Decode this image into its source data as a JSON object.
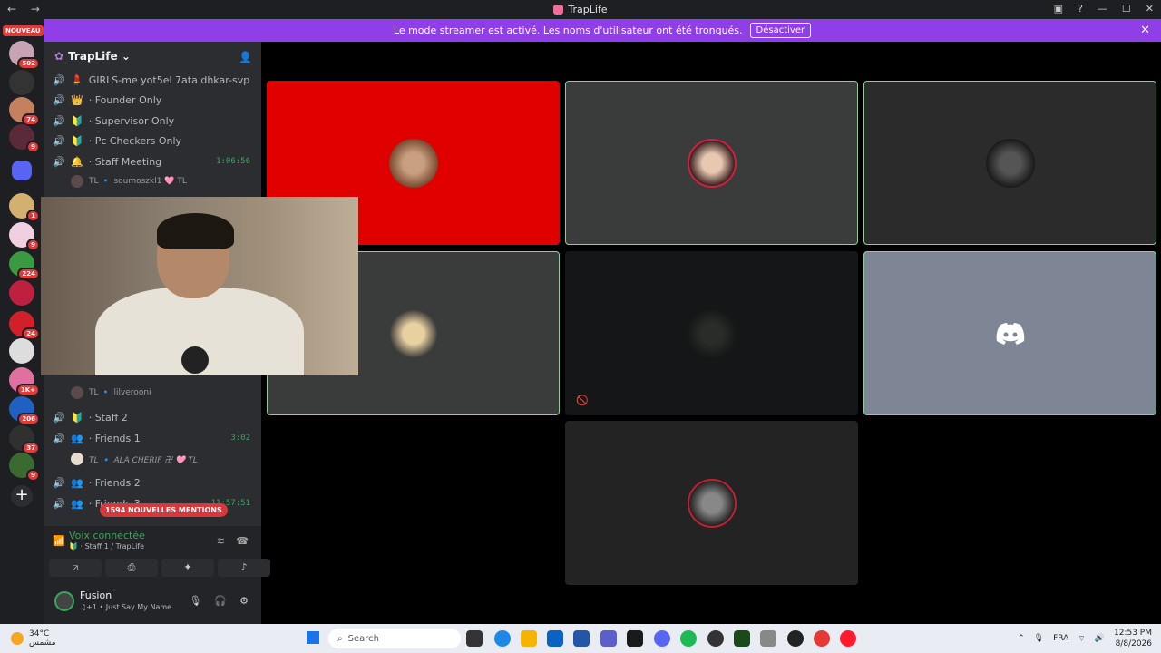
{
  "window": {
    "title": "TrapLife",
    "nav_glyphs": "← →"
  },
  "banner": {
    "text": "Le mode streamer est activé. Les noms d'utilisateur ont été tronqués.",
    "button": "Désactiver",
    "close": "✕"
  },
  "servers": {
    "nouveau": "NOUVEAU",
    "badges": [
      "502",
      "74",
      "9",
      "1",
      "9",
      "224",
      "24",
      "1K+",
      "206",
      "37",
      "9"
    ]
  },
  "guild": {
    "name": "TrapLife ⌄"
  },
  "channels": [
    {
      "icon": "💄",
      "name": "GIRLS-me yot5el 7ata dhkar-svp",
      "time": ""
    },
    {
      "icon": "👑",
      "name": "· Founder Only",
      "time": ""
    },
    {
      "icon": "🔰",
      "name": "· Supervisor Only",
      "time": ""
    },
    {
      "icon": "🔰",
      "name": "· Pc Checkers Only",
      "time": ""
    },
    {
      "icon": "🔔",
      "name": "· Staff Meeting",
      "time": "1:06:56"
    },
    {
      "icon": "🔰",
      "name": "· Staff 2",
      "time": ""
    },
    {
      "icon": "👥",
      "name": "· Friends 1",
      "time": "3:02"
    },
    {
      "icon": "👥",
      "name": "· Friends 2",
      "time": ""
    },
    {
      "icon": "👥",
      "name": "· Friends 3",
      "time": "11:57:51"
    }
  ],
  "members": [
    {
      "name": "TL 🔹 soumoszkl1 🩷 TL"
    },
    {
      "name": "TL 🔹 lilverooni"
    },
    {
      "name": "TL 🔹 ALA CHERIF 卍 🩷 TL"
    }
  ],
  "mentions": "1594 NOUVELLES MENTIONS",
  "voice": {
    "status": "Voix connectée",
    "channel": "🔰 · Staff 1 / TrapLife"
  },
  "user": {
    "name": "Fusion",
    "status": "♫+1 • Just Say My Name"
  },
  "taskbar": {
    "temp": "34°C",
    "weather_text": "مشمس",
    "search": "Search",
    "lang": "FRA",
    "time": "12:53 PM",
    "date": "8/8/2026"
  },
  "colors": {
    "accent": "#8f3ee8",
    "speaking": "#7bd88f",
    "red_tile": "#e00000"
  }
}
